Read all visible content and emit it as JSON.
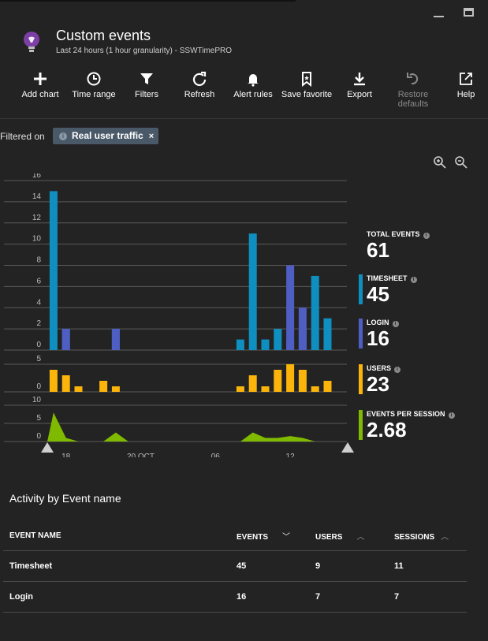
{
  "window": {
    "minimize": "minimize",
    "maximize": "maximize"
  },
  "header": {
    "title": "Custom events",
    "subtitle": "Last 24 hours (1 hour granularity) - SSWTimePRO",
    "icon": "lightbulb-icon",
    "accent": "#7b3fa6"
  },
  "toolbar": {
    "add_chart": "Add chart",
    "time_range": "Time range",
    "filters": "Filters",
    "refresh": "Refresh",
    "alert_rules": "Alert rules",
    "save_favorite": "Save favorite",
    "export": "Export",
    "restore_defaults": "Restore defaults",
    "help": "Help"
  },
  "filter": {
    "label": "Filtered on",
    "chip": "Real user traffic",
    "remove": "×"
  },
  "metrics": {
    "total": {
      "label": "TOTAL EVENTS",
      "value": "61"
    },
    "timesheet": {
      "label": "TIMESHEET",
      "value": "45",
      "color": "#0f8fc0"
    },
    "login": {
      "label": "LOGIN",
      "value": "16",
      "color": "#4f5ec2"
    },
    "users": {
      "label": "USERS",
      "value": "23",
      "color": "#fbb40a"
    },
    "eps": {
      "label": "EVENTS PER SESSION",
      "value": "2.68",
      "color": "#7fba00"
    }
  },
  "chart_data": [
    {
      "type": "bar",
      "stacked": true,
      "ylim": [
        0,
        16
      ],
      "yticks": [
        "16",
        "14",
        "12",
        "10",
        "8",
        "6",
        "4",
        "2",
        "0"
      ],
      "slots": 24,
      "series": [
        {
          "name": "TIMESHEET",
          "color": "#0f8fc0",
          "values": [
            15,
            2,
            0,
            0,
            0,
            2,
            0,
            0,
            0,
            0,
            0,
            0,
            0,
            0,
            0,
            1,
            11,
            1,
            2,
            1,
            2,
            7,
            3,
            0
          ]
        },
        {
          "name": "LOGIN",
          "color": "#4f5ec2",
          "values": [
            0,
            2,
            0,
            0,
            0,
            2,
            0,
            0,
            0,
            0,
            0,
            0,
            0,
            0,
            0,
            0,
            0,
            0,
            0,
            8,
            4,
            0,
            0,
            0
          ]
        }
      ]
    },
    {
      "type": "bar",
      "ylim": [
        0,
        5
      ],
      "yticks": [
        "5",
        "0"
      ],
      "slots": 24,
      "series": [
        {
          "name": "USERS",
          "color": "#fbb40a",
          "values": [
            4,
            3,
            1,
            0,
            2,
            1,
            0,
            0,
            0,
            0,
            0,
            0,
            0,
            0,
            0,
            1,
            3,
            1,
            4,
            5,
            4,
            1,
            2,
            0
          ]
        }
      ]
    },
    {
      "type": "area",
      "ylim": [
        0,
        10
      ],
      "yticks": [
        "10",
        "5",
        "0"
      ],
      "slots": 24,
      "series": [
        {
          "name": "EVENTS PER SESSION",
          "color": "#7fba00",
          "values": [
            8,
            1,
            0,
            0,
            0,
            2.5,
            0,
            0,
            0,
            0,
            0,
            0,
            0,
            0,
            0,
            0,
            2.5,
            1,
            1,
            1.5,
            1,
            0,
            0,
            0
          ]
        }
      ],
      "xticks": [
        {
          "label": "18",
          "slot": 1.5
        },
        {
          "label": "20 OCT",
          "slot": 7.5
        },
        {
          "label": "06",
          "slot": 13.5
        },
        {
          "label": "12",
          "slot": 19.5
        }
      ]
    }
  ],
  "table": {
    "title": "Activity by Event name",
    "headers": {
      "event_name": "EVENT NAME",
      "events": "EVENTS",
      "users": "USERS",
      "sessions": "SESSIONS"
    },
    "rows": [
      {
        "name": "Timesheet",
        "events": "45",
        "users": "9",
        "sessions": "11"
      },
      {
        "name": "Login",
        "events": "16",
        "users": "7",
        "sessions": "7"
      }
    ]
  }
}
